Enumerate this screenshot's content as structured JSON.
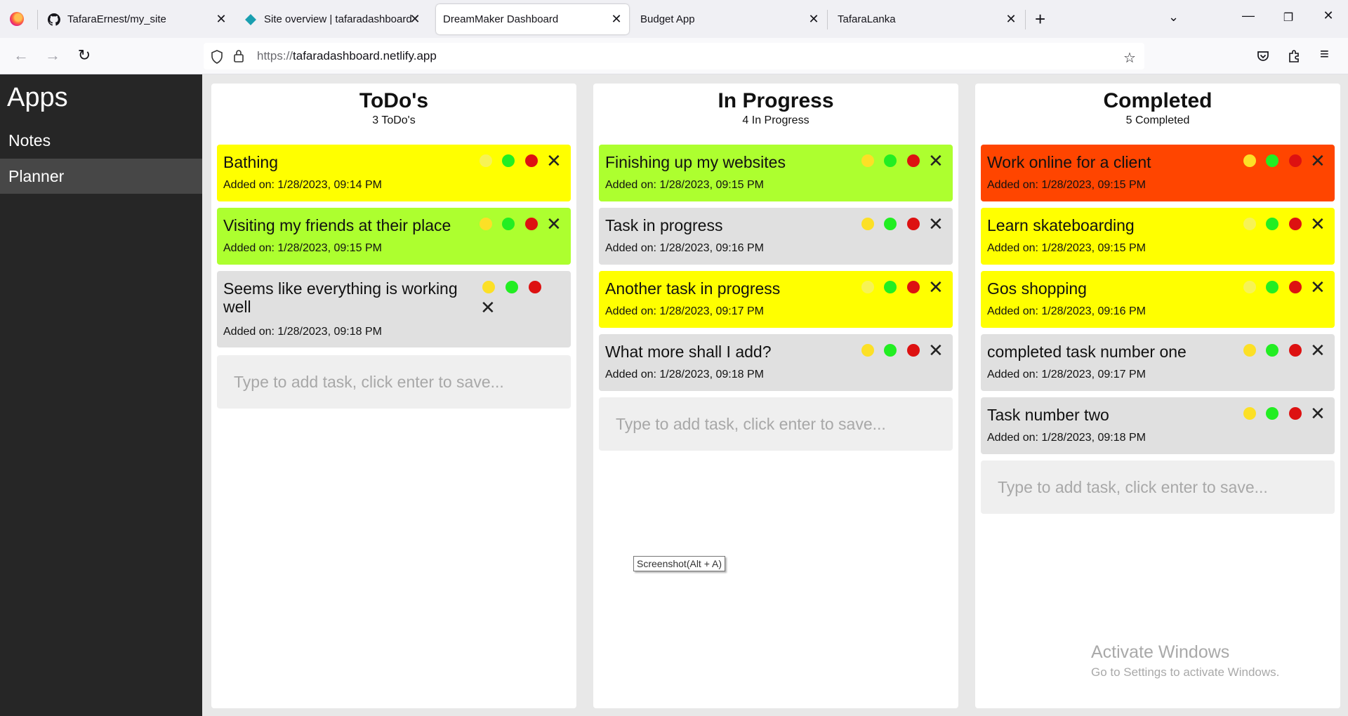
{
  "browser": {
    "tabs": [
      {
        "label": "TafaraErnest/my_site",
        "icon": "github-icon"
      },
      {
        "label": "Site overview | tafaradashboard",
        "icon": "netlify-icon"
      },
      {
        "label": "DreamMaker Dashboard",
        "icon": "",
        "active": true
      },
      {
        "label": "Budget App",
        "icon": ""
      },
      {
        "label": "TafaraLanka",
        "icon": ""
      }
    ],
    "url_protocol": "https://",
    "url_host": "tafaradashboard.netlify.app",
    "tooltip": "Screenshot(Alt + A)"
  },
  "sidebar": {
    "title": "Apps",
    "items": [
      {
        "label": "Notes"
      },
      {
        "label": "Planner",
        "active": true
      }
    ]
  },
  "columns": [
    {
      "title": "ToDo's",
      "count": "3 ToDo's",
      "placeholder": "Type to add task, click enter to save...",
      "cards": [
        {
          "text": "Bathing",
          "date": "Added on: 1/28/2023, 09:14 PM",
          "color": "#ffff00"
        },
        {
          "text": "Visiting my friends at their place",
          "date": "Added on: 1/28/2023, 09:15 PM",
          "color": "#adff2f"
        },
        {
          "text": "Seems like everything is working well",
          "date": "Added on: 1/28/2023, 09:18 PM",
          "color": "#e0e0e0"
        }
      ]
    },
    {
      "title": "In Progress",
      "count": "4 In Progress",
      "placeholder": "Type to add task, click enter to save...",
      "cards": [
        {
          "text": "Finishing up my websites",
          "date": "Added on: 1/28/2023, 09:15 PM",
          "color": "#adff2f"
        },
        {
          "text": "Task in progress",
          "date": "Added on: 1/28/2023, 09:16 PM",
          "color": "#e0e0e0"
        },
        {
          "text": "Another task in progress",
          "date": "Added on: 1/28/2023, 09:17 PM",
          "color": "#ffff00"
        },
        {
          "text": "What more shall I add?",
          "date": "Added on: 1/28/2023, 09:18 PM",
          "color": "#e0e0e0"
        }
      ]
    },
    {
      "title": "Completed",
      "count": "5 Completed",
      "placeholder": "Type to add task, click enter to save...",
      "cards": [
        {
          "text": "Work online for a client",
          "date": "Added on: 1/28/2023, 09:15 PM",
          "color": "#ff4500"
        },
        {
          "text": "Learn skateboarding",
          "date": "Added on: 1/28/2023, 09:15 PM",
          "color": "#ffff00"
        },
        {
          "text": "Gos shopping",
          "date": "Added on: 1/28/2023, 09:16 PM",
          "color": "#ffff00"
        },
        {
          "text": "completed task number one",
          "date": "Added on: 1/28/2023, 09:17 PM",
          "color": "#e0e0e0"
        },
        {
          "text": "Task number two",
          "date": "Added on: 1/28/2023, 09:18 PM",
          "color": "#e0e0e0"
        }
      ]
    }
  ],
  "watermark": {
    "line1": "Activate Windows",
    "line2": "Go to Settings to activate Windows."
  }
}
